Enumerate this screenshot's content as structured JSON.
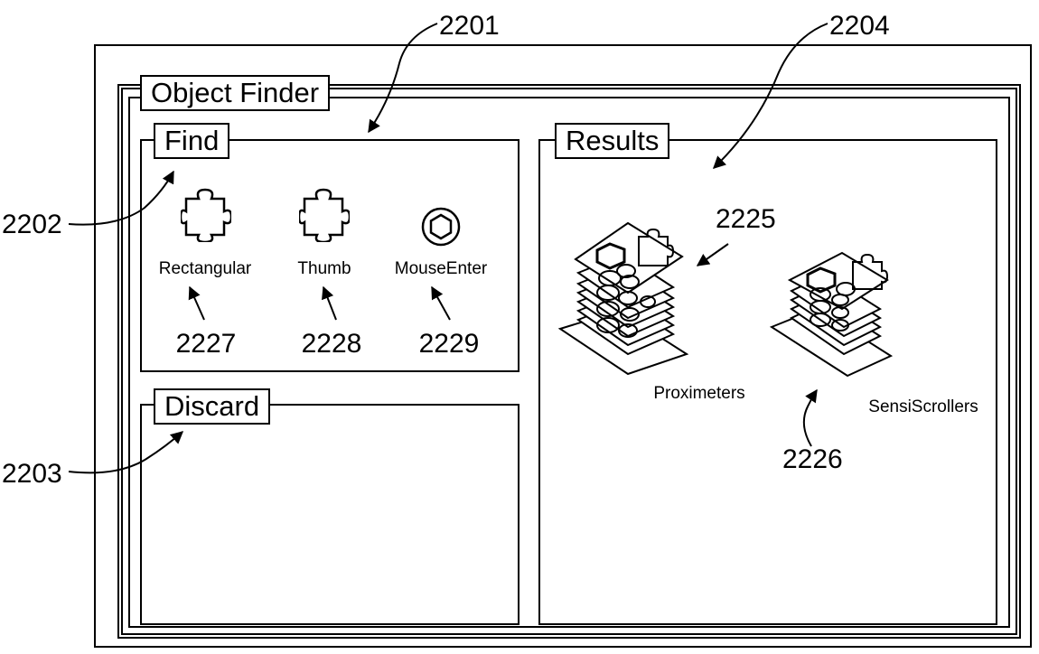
{
  "window": {
    "title": "Object Finder"
  },
  "panels": {
    "find": {
      "title": "Find",
      "items": [
        {
          "label": "Rectangular",
          "icon": "puzzle-piece-icon",
          "ref": "2227"
        },
        {
          "label": "Thumb",
          "icon": "puzzle-piece-icon",
          "ref": "2228"
        },
        {
          "label": "MouseEnter",
          "icon": "hexagon-button-icon",
          "ref": "2229"
        }
      ]
    },
    "discard": {
      "title": "Discard"
    },
    "results": {
      "title": "Results",
      "items": [
        {
          "label": "Proximeters",
          "icon": "stacked-objects-icon",
          "ref": "2225"
        },
        {
          "label": "SensiScrollers",
          "icon": "stacked-objects-icon",
          "ref": "2226"
        }
      ]
    }
  },
  "callouts": {
    "find_panel": "2201",
    "find_title": "2202",
    "discard_title": "2203",
    "results_panel": "2204"
  }
}
